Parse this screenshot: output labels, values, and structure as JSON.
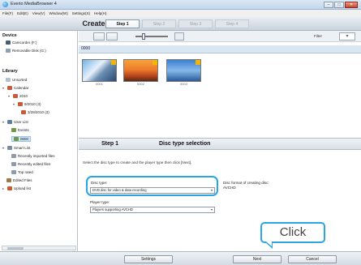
{
  "window": {
    "title": "Everio MediaBrowser 4",
    "min": "–",
    "max": "□",
    "close": "✕"
  },
  "menu": [
    "File(F)",
    "Edit(E)",
    "View(V)",
    "Window(W)",
    "Settings(S)",
    "Help(H)"
  ],
  "header": {
    "title": "Create Disc",
    "steps": [
      "Step 1",
      "Step 2",
      "Step 3",
      "Step 4"
    ]
  },
  "sidebar": {
    "device_title": "Device",
    "devices": [
      "Camcorder (F:)",
      "Removable Disk (G:)"
    ],
    "library_title": "Library",
    "library_items": [
      "Unsorted",
      "Calendar",
      "2010",
      "9/2010 (3)",
      "3/28/2010 (3)",
      "User List",
      "Events",
      "0000",
      "Smart List",
      "Recently imported files",
      "Recently edited files",
      "Top rated",
      "Edited Files",
      "Upload list"
    ]
  },
  "toolbar": {
    "filter_label": "Filter"
  },
  "content": {
    "date_header": "0000",
    "thumbnails": [
      "0001",
      "0002",
      "0003"
    ]
  },
  "step": {
    "number": "Step 1",
    "name": "Disc type selection",
    "instruction": "Select the disc type to create and the player type then click [Next].",
    "disc_type_label": "Disc type:",
    "disc_type_value": "DVD disc for video & data recording",
    "player_type_label": "Player type:",
    "player_type_value": "Players supporting AVCHD",
    "format_label": "Disc format of creating disc:",
    "format_value": "AVCHD"
  },
  "callout": {
    "text": "Click"
  },
  "buttons": {
    "settings": "Settings",
    "next": "Next",
    "cancel": "Cancel"
  },
  "colors": {
    "highlight": "#2aa5e6",
    "selected_row": "#cde4f7"
  }
}
